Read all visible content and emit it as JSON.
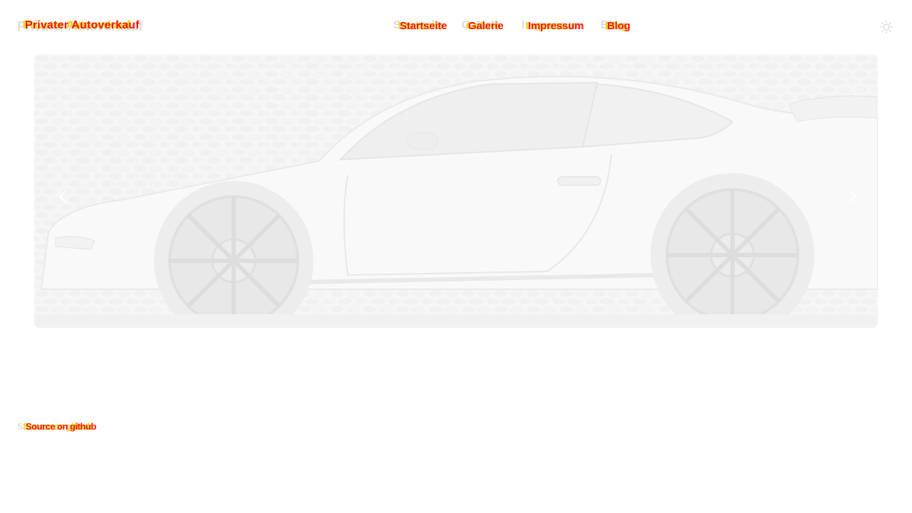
{
  "header": {
    "brand": "Privater Autoverkauf",
    "nav": {
      "startseite": "Startseite",
      "galerie": "Galerie",
      "impressum": "Impressum",
      "blog": "Blog"
    },
    "theme_toggle_icon": "sun-icon"
  },
  "hero": {
    "image_icon": "car-photo",
    "prev_icon": "chevron-left-icon",
    "next_icon": "chevron-right-icon"
  },
  "footer": {
    "source_link": "Source on github"
  },
  "colors": {
    "ghost_grey": "#dcdcdc",
    "accent_yellow": "#f0d400",
    "accent_red": "#f01800",
    "hero_bg": "#f2f2f2"
  }
}
